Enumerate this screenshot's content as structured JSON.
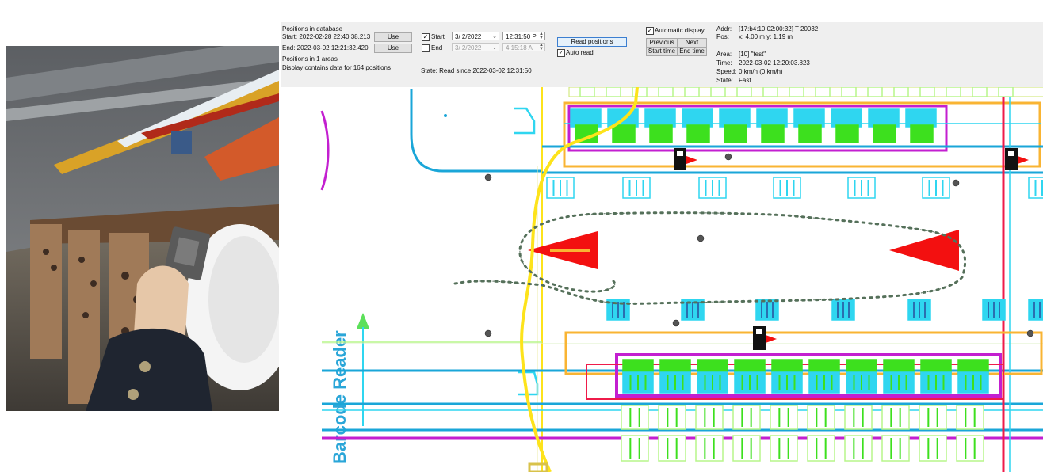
{
  "photo": {
    "description_icon": "person-holding-tag-scanner"
  },
  "panel": {
    "positions_in_db_label": "Positions in database",
    "start_row": {
      "text": "Start: 2022-02-28 22:40:38.213",
      "use_label": "Use"
    },
    "end_row": {
      "text": "End: 2022-03-02 12:21:32.420",
      "use_label": "Use"
    },
    "positions_areas": "Positions in 1 areas",
    "display_contains": "Display contains data for 164 positions",
    "start_check": {
      "label": "Start",
      "checked": "✓"
    },
    "end_check": {
      "label": "End",
      "checked": ""
    },
    "start_date": "3/ 2/2022",
    "start_time": "12:31:50 P",
    "end_date": "3/ 2/2022",
    "end_time": "4:15:18 A",
    "read_positions_label": "Read positions",
    "auto_read": {
      "label": "Auto read",
      "checked": "✓"
    },
    "state_text": "State: Read since 2022-03-02 12:31:50",
    "auto_display": {
      "label": "Automatic display",
      "checked": "✓"
    },
    "previous_label": "Previous",
    "next_label": "Next",
    "start_time_label": "Start time",
    "end_time_label": "End time"
  },
  "info": {
    "addr_label": "Addr:",
    "addr_value": "[17:b4:10:02:00:32]  T 20032",
    "pos_label": "Pos:",
    "pos_value": "x: 4.00 m  y: 1.19 m",
    "area_label": "Area:",
    "area_value": "[10]  \"test\"",
    "time_label": "Time:",
    "time_value": "2022-03-02 12:20:03.823",
    "speed_label": "Speed:",
    "speed_value": "0 km/h  (0 km/h)",
    "state_label": "State:",
    "state_value": "Fast"
  },
  "map": {
    "reader_label": "Barcode Reader",
    "colors": {
      "cyan": "#2fd6f0",
      "blue": "#1aa6d8",
      "magenta": "#b41fc4",
      "yellow": "#fde31b",
      "orange": "#f9b433",
      "green": "#3de01e",
      "red": "#f31010",
      "lightgreen": "#b7f58a",
      "track": "#55705a"
    }
  }
}
